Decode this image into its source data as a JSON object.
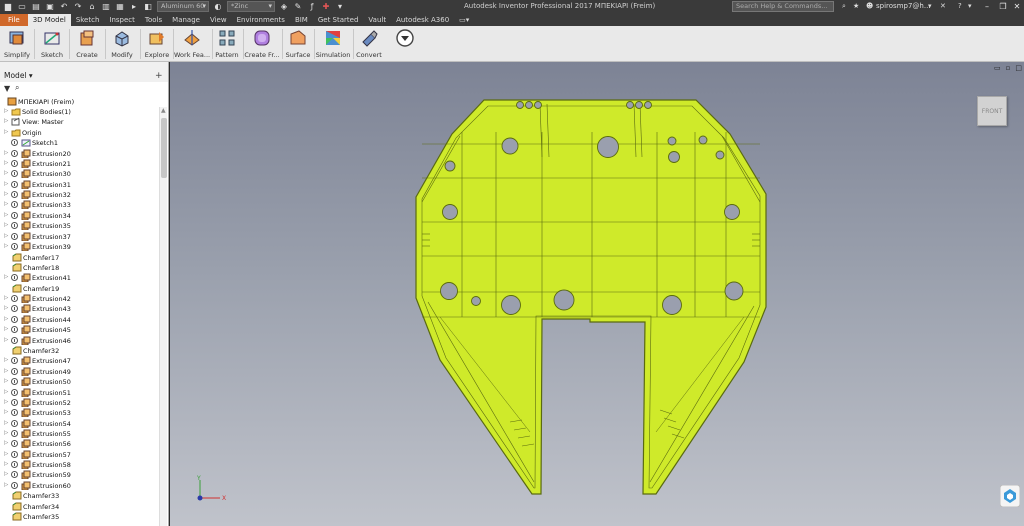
{
  "title_bar": {
    "material": "Aluminum 60",
    "appearance": "*Zinc",
    "app_title": "Autodesk Inventor Professional 2017   ΜΠΕΚΙΑΡΙ (Freim)",
    "search_placeholder": "Search Help & Commands...",
    "user": "spirosmp7@h...",
    "help": "?"
  },
  "tabs": [
    "File",
    "3D Model",
    "Sketch",
    "Inspect",
    "Tools",
    "Manage",
    "View",
    "Environments",
    "BIM",
    "Get Started",
    "Vault",
    "Autodesk A360"
  ],
  "active_tab": "3D Model",
  "ribbon": [
    {
      "label": "Simplify",
      "icon": "simplify-icon"
    },
    {
      "label": "Sketch",
      "icon": "sketch-icon"
    },
    {
      "label": "Create",
      "icon": "create-icon"
    },
    {
      "label": "Modify",
      "icon": "modify-icon"
    },
    {
      "label": "Explore",
      "icon": "explore-icon"
    },
    {
      "label": "Work Fea...",
      "icon": "work-features-icon"
    },
    {
      "label": "Pattern",
      "icon": "pattern-icon"
    },
    {
      "label": "Create Fr...",
      "icon": "create-freeform-icon"
    },
    {
      "label": "Surface",
      "icon": "surface-icon"
    },
    {
      "label": "Simulation",
      "icon": "simulation-icon"
    },
    {
      "label": "Convert",
      "icon": "convert-icon"
    }
  ],
  "browser": {
    "title": "Model",
    "tree": [
      {
        "label": "ΜΠΕΚΙΑΡΙ (Freim)",
        "type": "part",
        "expand": false,
        "vis": false,
        "indent": 0
      },
      {
        "label": "Solid Bodies(1)",
        "type": "folder",
        "expand": true,
        "vis": false,
        "indent": 1
      },
      {
        "label": "View: Master",
        "type": "view",
        "expand": true,
        "vis": false,
        "indent": 1
      },
      {
        "label": "Origin",
        "type": "folder",
        "expand": true,
        "vis": false,
        "indent": 1
      },
      {
        "label": "Sketch1",
        "type": "sketch",
        "expand": false,
        "vis": true,
        "indent": 1
      },
      {
        "label": "Extrusion20",
        "type": "extrusion",
        "expand": true,
        "vis": true,
        "indent": 1
      },
      {
        "label": "Extrusion21",
        "type": "extrusion",
        "expand": true,
        "vis": true,
        "indent": 1
      },
      {
        "label": "Extrusion30",
        "type": "extrusion",
        "expand": true,
        "vis": true,
        "indent": 1
      },
      {
        "label": "Extrusion31",
        "type": "extrusion",
        "expand": true,
        "vis": true,
        "indent": 1
      },
      {
        "label": "Extrusion32",
        "type": "extrusion",
        "expand": true,
        "vis": true,
        "indent": 1
      },
      {
        "label": "Extrusion33",
        "type": "extrusion",
        "expand": true,
        "vis": true,
        "indent": 1
      },
      {
        "label": "Extrusion34",
        "type": "extrusion",
        "expand": true,
        "vis": true,
        "indent": 1
      },
      {
        "label": "Extrusion35",
        "type": "extrusion",
        "expand": true,
        "vis": true,
        "indent": 1
      },
      {
        "label": "Extrusion37",
        "type": "extrusion",
        "expand": true,
        "vis": true,
        "indent": 1
      },
      {
        "label": "Extrusion39",
        "type": "extrusion",
        "expand": true,
        "vis": true,
        "indent": 1
      },
      {
        "label": "Chamfer17",
        "type": "chamfer",
        "expand": false,
        "vis": false,
        "indent": 1
      },
      {
        "label": "Chamfer18",
        "type": "chamfer",
        "expand": false,
        "vis": false,
        "indent": 1
      },
      {
        "label": "Extrusion41",
        "type": "extrusion",
        "expand": true,
        "vis": true,
        "indent": 1
      },
      {
        "label": "Chamfer19",
        "type": "chamfer",
        "expand": false,
        "vis": false,
        "indent": 1
      },
      {
        "label": "Extrusion42",
        "type": "extrusion",
        "expand": true,
        "vis": true,
        "indent": 1
      },
      {
        "label": "Extrusion43",
        "type": "extrusion",
        "expand": true,
        "vis": true,
        "indent": 1
      },
      {
        "label": "Extrusion44",
        "type": "extrusion",
        "expand": true,
        "vis": true,
        "indent": 1
      },
      {
        "label": "Extrusion45",
        "type": "extrusion",
        "expand": true,
        "vis": true,
        "indent": 1
      },
      {
        "label": "Extrusion46",
        "type": "extrusion",
        "expand": true,
        "vis": true,
        "indent": 1
      },
      {
        "label": "Chamfer32",
        "type": "chamfer",
        "expand": false,
        "vis": false,
        "indent": 1
      },
      {
        "label": "Extrusion47",
        "type": "extrusion",
        "expand": true,
        "vis": true,
        "indent": 1
      },
      {
        "label": "Extrusion49",
        "type": "extrusion",
        "expand": true,
        "vis": true,
        "indent": 1
      },
      {
        "label": "Extrusion50",
        "type": "extrusion",
        "expand": true,
        "vis": true,
        "indent": 1
      },
      {
        "label": "Extrusion51",
        "type": "extrusion",
        "expand": true,
        "vis": true,
        "indent": 1
      },
      {
        "label": "Extrusion52",
        "type": "extrusion",
        "expand": true,
        "vis": true,
        "indent": 1
      },
      {
        "label": "Extrusion53",
        "type": "extrusion",
        "expand": true,
        "vis": true,
        "indent": 1
      },
      {
        "label": "Extrusion54",
        "type": "extrusion",
        "expand": true,
        "vis": true,
        "indent": 1
      },
      {
        "label": "Extrusion55",
        "type": "extrusion",
        "expand": true,
        "vis": true,
        "indent": 1
      },
      {
        "label": "Extrusion56",
        "type": "extrusion",
        "expand": true,
        "vis": true,
        "indent": 1
      },
      {
        "label": "Extrusion57",
        "type": "extrusion",
        "expand": true,
        "vis": true,
        "indent": 1
      },
      {
        "label": "Extrusion58",
        "type": "extrusion",
        "expand": true,
        "vis": true,
        "indent": 1
      },
      {
        "label": "Extrusion59",
        "type": "extrusion",
        "expand": true,
        "vis": true,
        "indent": 1
      },
      {
        "label": "Extrusion60",
        "type": "extrusion",
        "expand": true,
        "vis": true,
        "indent": 1
      },
      {
        "label": "Chamfer33",
        "type": "chamfer",
        "expand": false,
        "vis": false,
        "indent": 1
      },
      {
        "label": "Chamfer34",
        "type": "chamfer",
        "expand": false,
        "vis": false,
        "indent": 1
      },
      {
        "label": "Chamfer35",
        "type": "chamfer",
        "expand": false,
        "vis": false,
        "indent": 1
      }
    ]
  },
  "viewport": {
    "viewcube_label": "FRONT",
    "part_color": "#cfea2a",
    "part_edge_color": "#5a6a10",
    "triad": {
      "y": "Y",
      "x": "X"
    }
  },
  "colors": {
    "file_tab": "#d0682a",
    "chrome_dark": "#3a3a3a",
    "ribbon_bg": "#e9e9e9"
  }
}
